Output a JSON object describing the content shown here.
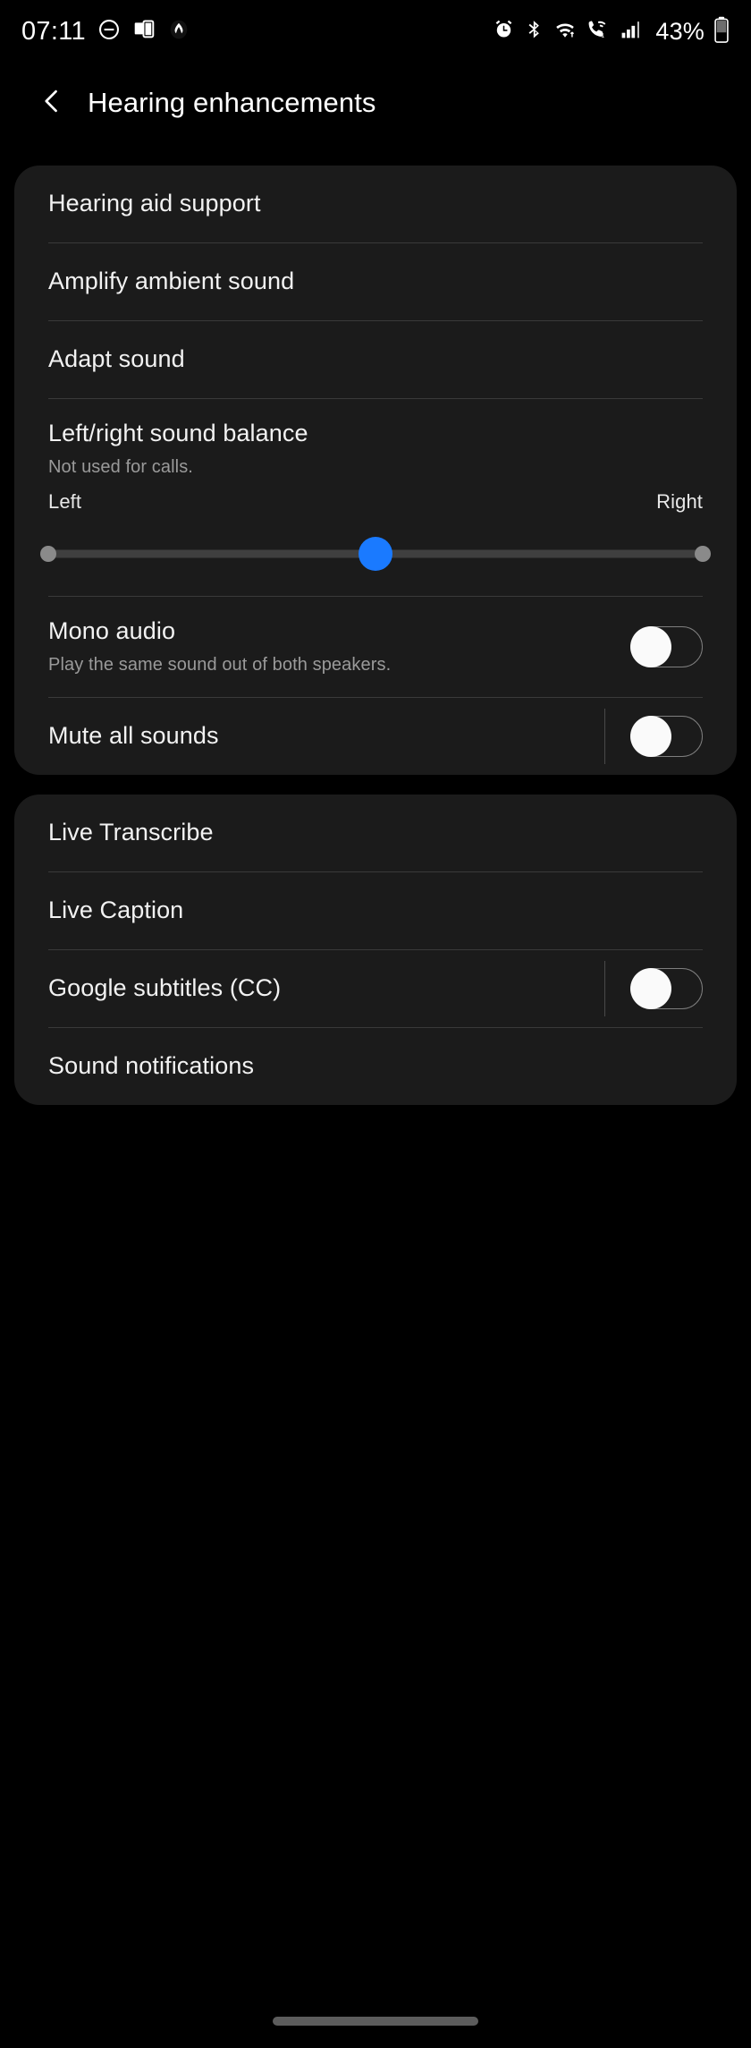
{
  "status_bar": {
    "time": "07:11",
    "battery_percent": "43%",
    "left_icons": [
      "do-not-disturb-icon",
      "screen-mirroring-icon",
      "app-notification-icon"
    ],
    "right_icons": [
      "alarm-icon",
      "bluetooth-icon",
      "wifi-icon",
      "wifi-calling-icon",
      "signal-bars-icon",
      "battery-icon"
    ]
  },
  "header": {
    "back_label": "back-chevron",
    "title": "Hearing enhancements"
  },
  "sections": [
    {
      "id": "hearing-section",
      "rows": [
        {
          "id": "hearing-aid-support",
          "title": "Hearing aid support",
          "subtitle": "",
          "control": "none"
        },
        {
          "id": "amplify-ambient-sound",
          "title": "Amplify ambient sound",
          "subtitle": "",
          "control": "none"
        },
        {
          "id": "adapt-sound",
          "title": "Adapt sound",
          "subtitle": "",
          "control": "none"
        },
        {
          "id": "left-right-sound-balance",
          "title": "Left/right sound balance",
          "subtitle": "Not used for calls.",
          "control": "slider"
        },
        {
          "id": "mono-audio",
          "title": "Mono audio",
          "subtitle": "Play the same sound out of both speakers.",
          "control": "toggle",
          "toggle_state": "off",
          "has_separator": false
        },
        {
          "id": "mute-all-sounds",
          "title": "Mute all sounds",
          "subtitle": "",
          "control": "toggle",
          "toggle_state": "off",
          "has_separator": true
        }
      ]
    },
    {
      "id": "captions-section",
      "rows": [
        {
          "id": "live-transcribe",
          "title": "Live Transcribe",
          "subtitle": "",
          "control": "none"
        },
        {
          "id": "live-caption",
          "title": "Live Caption",
          "subtitle": "",
          "control": "none"
        },
        {
          "id": "google-subtitles-cc",
          "title": "Google subtitles (CC)",
          "subtitle": "",
          "control": "toggle",
          "toggle_state": "off",
          "has_separator": true
        },
        {
          "id": "sound-notifications",
          "title": "Sound notifications",
          "subtitle": "",
          "control": "none"
        }
      ]
    }
  ],
  "balance_slider": {
    "left_label": "Left",
    "right_label": "Right",
    "value_percent": 50,
    "min_label": "Left",
    "max_label": "Right"
  },
  "colors": {
    "background": "#000000",
    "card": "#1b1b1b",
    "accent_blue": "#1a7aff",
    "primary_text": "#f2f2f2",
    "secondary_text": "#9a9a9a",
    "divider": "#3a3a3a"
  },
  "navigation_bar": {
    "gesture_pill": "home-gesture-pill"
  }
}
